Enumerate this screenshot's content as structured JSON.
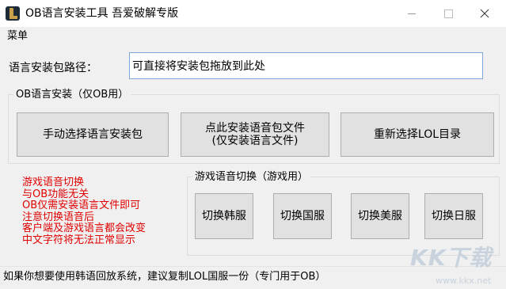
{
  "window": {
    "title": "OB语言安装工具 吾爱破解专版",
    "icons": {
      "app": "league-logo-icon",
      "minimize": "minimize-icon",
      "maximize": "maximize-icon",
      "close": "close-icon"
    }
  },
  "menu": {
    "items": [
      {
        "label": "菜单"
      }
    ]
  },
  "path": {
    "label": "语言安装包路径：",
    "value": "可直接将安装包拖放到此处"
  },
  "ob_group": {
    "legend": "OB语言安装（仅OB用）",
    "buttons": {
      "manual": "手动选择语言安装包",
      "install_line1": "点此安装语音包文件",
      "install_line2": "(仅安装语言文件)",
      "reselect": "重新选择LOL目录"
    }
  },
  "notes": {
    "color": "#e00000",
    "lines": [
      "游戏语音切换",
      "与OB功能无关",
      "OB仅需安装语言文件即可",
      "注意切换语音后",
      "客户端及游戏语言都会改变",
      "中文字符将无法正常显示"
    ]
  },
  "voice_group": {
    "legend": "游戏语音切换（游戏用）",
    "buttons": {
      "kr": "切换韩服",
      "cn": "切换国服",
      "us": "切换美服",
      "jp": "切换日服"
    }
  },
  "footer": {
    "text": "如果你想要使用韩语回放系统，建议复制LOL国服一份（专门用于OB）"
  },
  "watermark": {
    "logo": "KK下载",
    "url": "www.kkx.net"
  }
}
